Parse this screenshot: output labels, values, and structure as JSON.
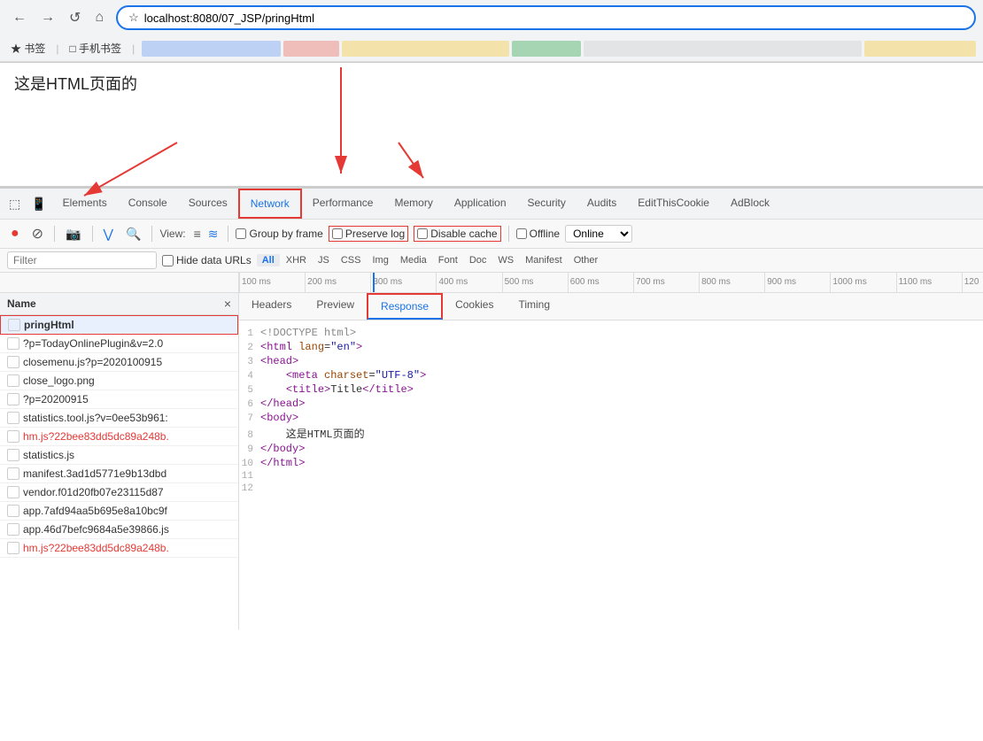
{
  "browser": {
    "back_btn": "←",
    "forward_btn": "→",
    "reload_btn": "↺",
    "home_btn": "⌂",
    "url": "localhost:8080/07_JSP/pringHtml",
    "star": "☆",
    "bookmarks": {
      "star_label": "★ 书签",
      "mobile_label": "□ 手机书签",
      "sep": "|",
      "tabs": [
        "",
        "",
        "",
        "",
        "",
        ""
      ]
    }
  },
  "page": {
    "heading": "这是HTML页面的"
  },
  "devtools": {
    "tabs": [
      {
        "label": "Elements",
        "active": false
      },
      {
        "label": "Console",
        "active": false
      },
      {
        "label": "Sources",
        "active": false
      },
      {
        "label": "Network",
        "active": true
      },
      {
        "label": "Performance",
        "active": false
      },
      {
        "label": "Memory",
        "active": false
      },
      {
        "label": "Application",
        "active": false
      },
      {
        "label": "Security",
        "active": false
      },
      {
        "label": "Audits",
        "active": false
      },
      {
        "label": "EditThisCookie",
        "active": false
      },
      {
        "label": "AdBlock",
        "active": false
      }
    ],
    "toolbar": {
      "record_icon": "⏺",
      "stop_icon": "⊘",
      "camera_icon": "📷",
      "filter_icon": "⋁",
      "search_icon": "🔍",
      "view_label": "View:",
      "group_label": "Group by frame",
      "preserve_log_label": "Preserve log",
      "disable_cache_label": "Disable cache",
      "offline_label": "Offline",
      "online_label": "Online",
      "dropdown": "▾"
    },
    "filter": {
      "placeholder": "Filter",
      "hide_urls_label": "Hide data URLs",
      "types": [
        "All",
        "XHR",
        "JS",
        "CSS",
        "Img",
        "Media",
        "Font",
        "Doc",
        "WS",
        "Manifest",
        "Other"
      ]
    },
    "timeline": {
      "ticks": [
        "100 ms",
        "200 ms",
        "300 ms",
        "400 ms",
        "500 ms",
        "600 ms",
        "700 ms",
        "800 ms",
        "900 ms",
        "1000 ms",
        "1100 ms",
        "120"
      ]
    },
    "file_list": {
      "header": "Name",
      "close_icon": "×",
      "items": [
        {
          "name": "pringHtml",
          "selected": true,
          "red": false
        },
        {
          "name": "?p=TodayOnlinePlugin&v=2.0",
          "selected": false,
          "red": false
        },
        {
          "name": "closemenu.js?p=2020100915",
          "selected": false,
          "red": false
        },
        {
          "name": "close_logo.png",
          "selected": false,
          "red": false
        },
        {
          "name": "?p=20200915",
          "selected": false,
          "red": false
        },
        {
          "name": "statistics.tool.js?v=0ee53b961:",
          "selected": false,
          "red": false
        },
        {
          "name": "hm.js?22bee83dd5dc89a248b.",
          "selected": false,
          "red": true
        },
        {
          "name": "statistics.js",
          "selected": false,
          "red": false
        },
        {
          "name": "manifest.3ad1d5771e9b13dbd",
          "selected": false,
          "red": false
        },
        {
          "name": "vendor.f01d20fb07e23115d87",
          "selected": false,
          "red": false
        },
        {
          "name": "app.7afd94aa5b695e8a10bc9f",
          "selected": false,
          "red": false
        },
        {
          "name": "app.46d7befc9684a5e39866.js",
          "selected": false,
          "red": false
        },
        {
          "name": "hm.js?22bee83dd5dc89a248b.",
          "selected": false,
          "red": true
        }
      ]
    },
    "response_tabs": [
      "Headers",
      "Preview",
      "Response",
      "Cookies",
      "Timing"
    ],
    "response_content": {
      "lines": [
        {
          "num": 1,
          "html": "<!DOCTYPE html>",
          "type": "doctype"
        },
        {
          "num": 2,
          "html": "<html lang=\"en\">",
          "type": "tag"
        },
        {
          "num": 3,
          "html": "<head>",
          "type": "tag"
        },
        {
          "num": 4,
          "html": "    <meta charset=\"UTF-8\">",
          "type": "tag"
        },
        {
          "num": 5,
          "html": "    <title>Title</title>",
          "type": "tag"
        },
        {
          "num": 6,
          "html": "</head>",
          "type": "tag"
        },
        {
          "num": 7,
          "html": "<body>",
          "type": "tag"
        },
        {
          "num": 8,
          "html": "    这是HTML页面的",
          "type": "text"
        },
        {
          "num": 9,
          "html": "</body>",
          "type": "tag"
        },
        {
          "num": 10,
          "html": "</html>",
          "type": "tag"
        },
        {
          "num": 11,
          "html": "",
          "type": "empty"
        },
        {
          "num": 12,
          "html": "",
          "type": "empty"
        }
      ]
    }
  },
  "annotations": {
    "arrow1_label": "Network tab arrow",
    "arrow2_label": "pringHtml file arrow",
    "arrow3_label": "Response tab arrow"
  }
}
